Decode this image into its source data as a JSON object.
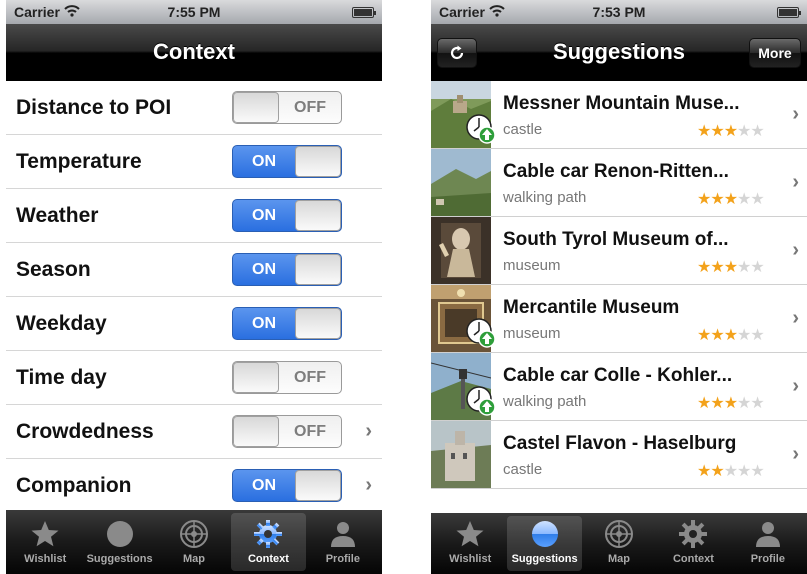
{
  "left_screen": {
    "status": {
      "carrier": "Carrier",
      "time": "7:55 PM"
    },
    "nav": {
      "title": "Context"
    },
    "settings": [
      {
        "label": "Distance to POI",
        "state": "OFF",
        "on": false,
        "chevron": false
      },
      {
        "label": "Temperature",
        "state": "ON",
        "on": true,
        "chevron": false
      },
      {
        "label": "Weather",
        "state": "ON",
        "on": true,
        "chevron": false
      },
      {
        "label": "Season",
        "state": "ON",
        "on": true,
        "chevron": false
      },
      {
        "label": "Weekday",
        "state": "ON",
        "on": true,
        "chevron": false
      },
      {
        "label": "Time day",
        "state": "OFF",
        "on": false,
        "chevron": false
      },
      {
        "label": "Crowdedness",
        "state": "OFF",
        "on": false,
        "chevron": true
      },
      {
        "label": "Companion",
        "state": "ON",
        "on": true,
        "chevron": true
      }
    ],
    "tabs": [
      {
        "label": "Wishlist",
        "icon": "star-icon"
      },
      {
        "label": "Suggestions",
        "icon": "circle-icon"
      },
      {
        "label": "Map",
        "icon": "radar-icon"
      },
      {
        "label": "Context",
        "icon": "gear-icon"
      },
      {
        "label": "Profile",
        "icon": "person-icon"
      }
    ],
    "active_tab": 3
  },
  "right_screen": {
    "status": {
      "carrier": "Carrier",
      "time": "7:53 PM"
    },
    "nav": {
      "title": "Suggestions",
      "refresh_icon": "refresh-icon",
      "more_label": "More"
    },
    "items": [
      {
        "title": "Messner Mountain Muse...",
        "category": "castle",
        "rating": 3,
        "badge": true
      },
      {
        "title": "Cable car Renon-Ritten...",
        "category": "walking path",
        "rating": 3,
        "badge": false
      },
      {
        "title": "South Tyrol Museum of...",
        "category": "museum",
        "rating": 3,
        "badge": false
      },
      {
        "title": "Mercantile Museum",
        "category": "museum",
        "rating": 3,
        "badge": true
      },
      {
        "title": "Cable car Colle - Kohler...",
        "category": "walking path",
        "rating": 3,
        "badge": true
      },
      {
        "title": "Castel Flavon - Haselburg",
        "category": "castle",
        "rating": 2,
        "badge": false
      }
    ],
    "tabs": [
      {
        "label": "Wishlist",
        "icon": "star-icon"
      },
      {
        "label": "Suggestions",
        "icon": "circle-icon"
      },
      {
        "label": "Map",
        "icon": "radar-icon"
      },
      {
        "label": "Context",
        "icon": "gear-icon"
      },
      {
        "label": "Profile",
        "icon": "person-icon"
      }
    ],
    "active_tab": 1
  },
  "colors": {
    "toggle_on": "#2a6fe0",
    "star_filled": "#f3a21b",
    "badge_green": "#2e9e3a"
  }
}
